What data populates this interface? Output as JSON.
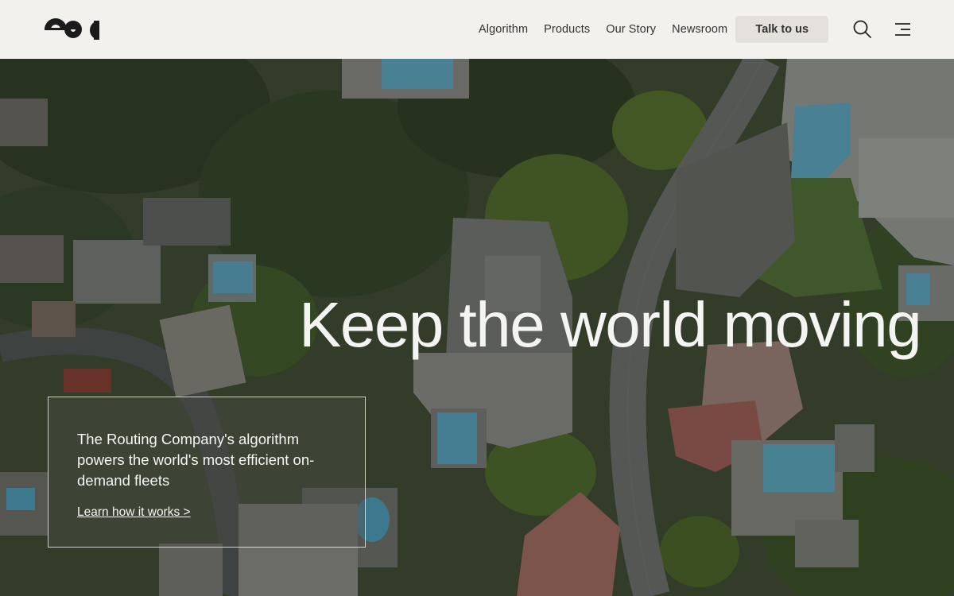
{
  "header": {
    "logo_name": "company-logo",
    "nav": [
      {
        "label": "Algorithm"
      },
      {
        "label": "Products"
      },
      {
        "label": "Our Story"
      },
      {
        "label": "Newsroom"
      }
    ],
    "cta_label": "Talk to us",
    "icons": {
      "search": "search-icon",
      "menu": "menu-icon"
    }
  },
  "hero": {
    "title": "Keep the world moving",
    "card": {
      "text": "The Routing Company's algorithm powers the world's most efficient on-demand fleets",
      "link": "Learn how it works >"
    },
    "background": "aerial photo of a hillside neighborhood with houses, pools, trees and a winding road"
  },
  "colors": {
    "header_bg": "#f3f1ed",
    "cta_bg": "#e4e1dc",
    "nav_text": "#333333",
    "hero_text": "#f4f4f2"
  }
}
